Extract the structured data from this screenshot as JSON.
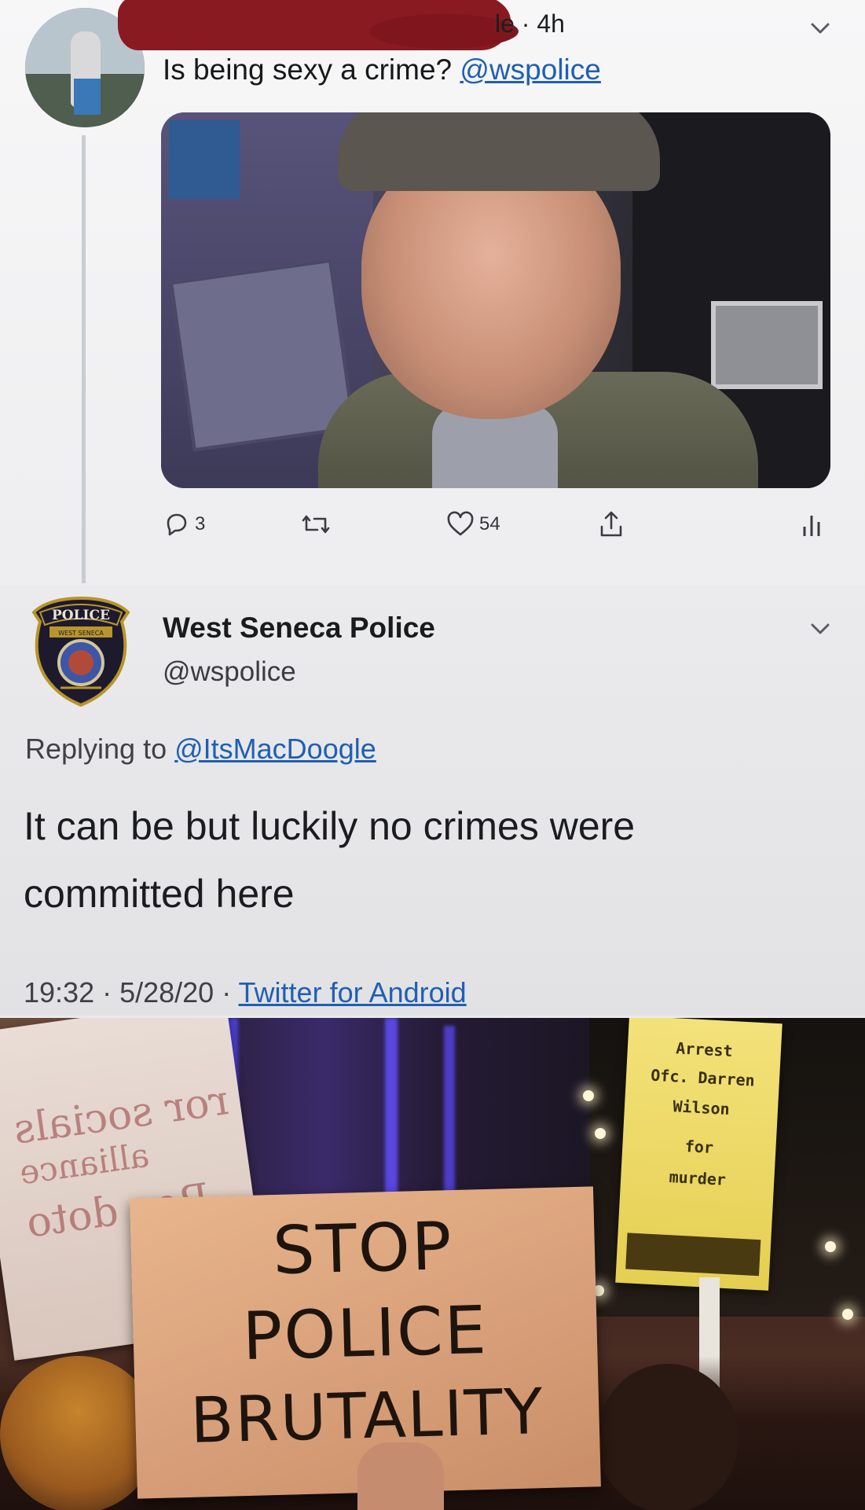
{
  "tweet": {
    "author_name_visible": "le",
    "time": "· 4h",
    "text": "Is being sexy a crime?",
    "mention": "@wspolice",
    "actions": {
      "reply_count": "3",
      "retweet_count": "",
      "like_count": "54"
    },
    "icons": [
      "reply-icon",
      "retweet-icon",
      "like-icon",
      "share-icon",
      "analytics-icon",
      "chevron-down-icon"
    ]
  },
  "reply": {
    "name": "West Seneca Police",
    "handle": "@wspolice",
    "replying_prefix": "Replying to",
    "replying_to": "@ItsMacDoogle",
    "text": "It can be but luckily no crimes were committed here",
    "timestamp": "19:32 · 5/28/20 ·",
    "source": "Twitter for Android",
    "badge_text": "POLICE",
    "badge_subtext": "WEST SENECA"
  },
  "photo": {
    "cardboard_sign": [
      "STOP",
      "POLICE",
      "BRUTALITY"
    ],
    "yellow_sign": [
      "Arrest",
      "Ofc. Darren",
      "Wilson",
      "for",
      "murder"
    ]
  },
  "colors": {
    "link": "#1f5fb5",
    "redaction": "#8a1a22",
    "cardboard": "#d8a07a",
    "yellow_sign": "#e5cf52"
  }
}
